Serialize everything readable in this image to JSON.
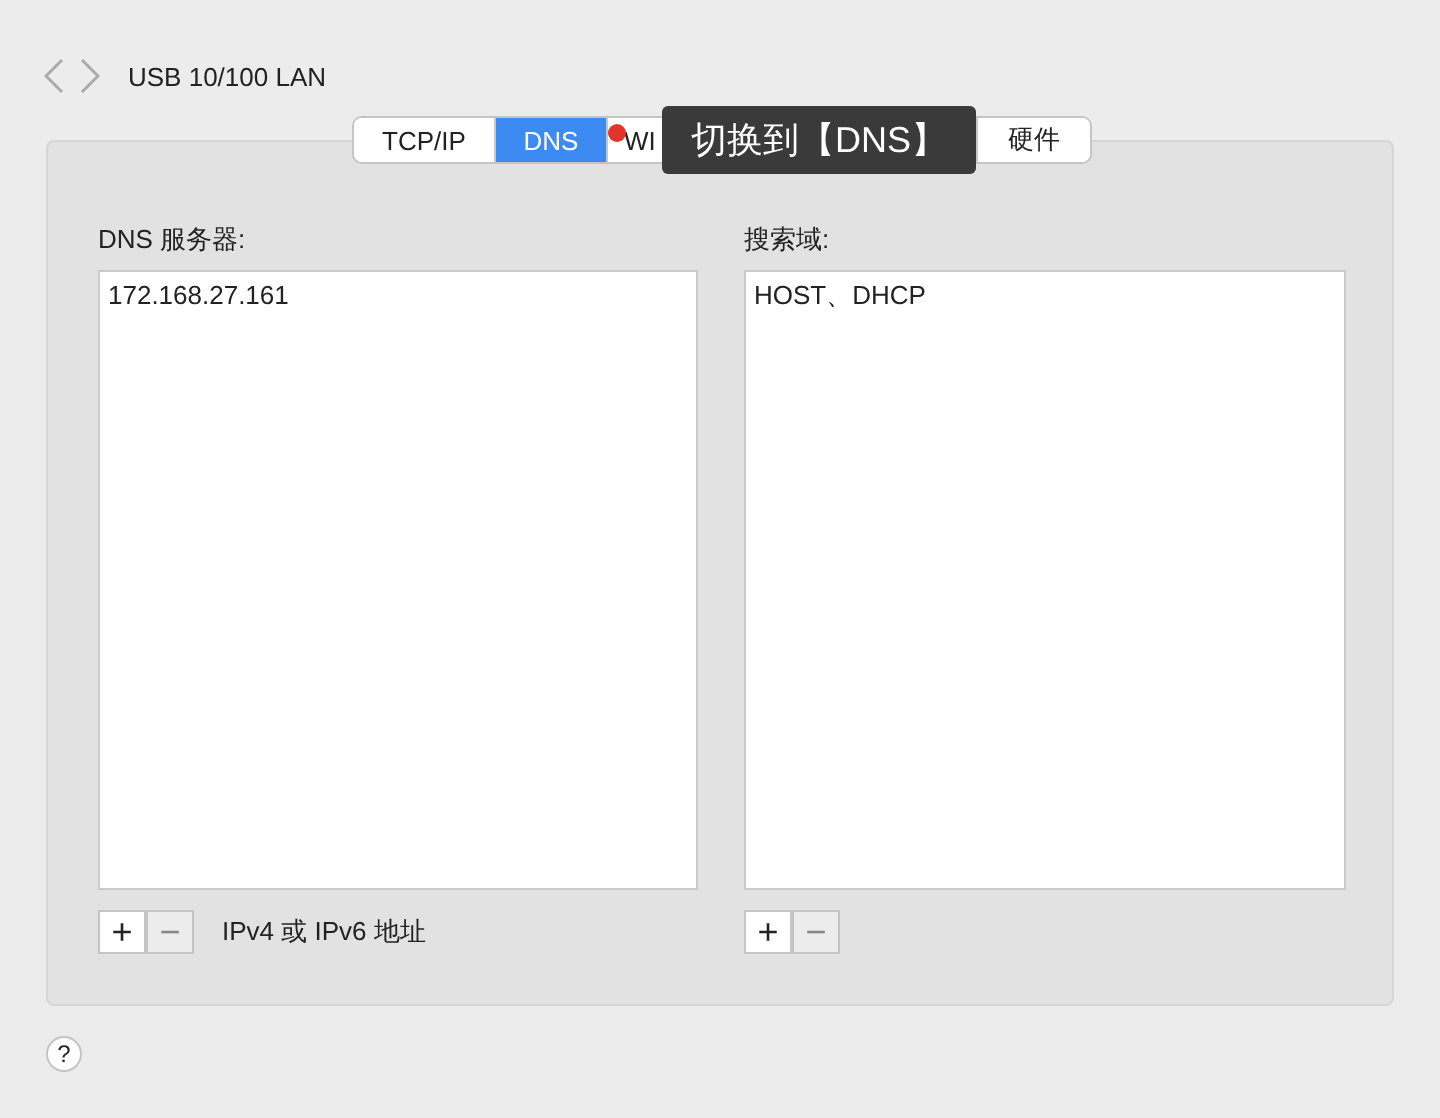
{
  "header": {
    "title": "USB 10/100 LAN"
  },
  "tabs": [
    {
      "label": "TCP/IP",
      "selected": false
    },
    {
      "label": "DNS",
      "selected": true
    },
    {
      "label": "WI",
      "selected": false
    },
    {
      "label": "硬件",
      "selected": false
    }
  ],
  "tooltip": {
    "text": "切换到【DNS】"
  },
  "dns_servers": {
    "label": "DNS 服务器:",
    "items": [
      "172.168.27.161"
    ],
    "hint": "IPv4 或 IPv6 地址",
    "add": "+",
    "remove": "−",
    "remove_disabled": true
  },
  "search_domains": {
    "label": "搜索域:",
    "items": [
      "HOST、DHCP"
    ],
    "add": "+",
    "remove": "−",
    "remove_disabled": true
  },
  "help": "?"
}
